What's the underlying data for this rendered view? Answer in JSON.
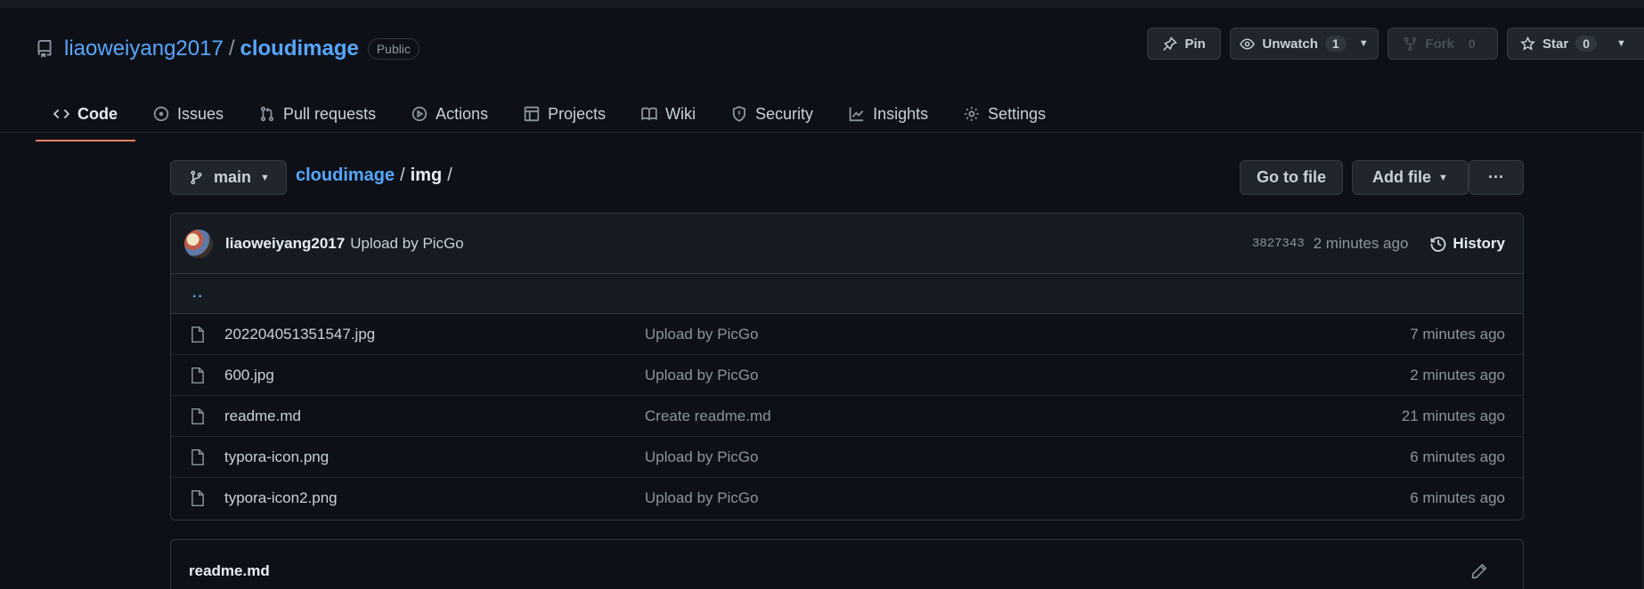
{
  "repo": {
    "owner": "liaoweiyang2017",
    "separator": "/",
    "name": "cloudimage",
    "visibility": "Public"
  },
  "header_buttons": {
    "pin": {
      "label": "Pin"
    },
    "unwatch": {
      "label": "Unwatch",
      "count": "1"
    },
    "fork": {
      "label": "Fork",
      "count": "0"
    },
    "star": {
      "label": "Star",
      "count": "0"
    }
  },
  "tabs": [
    {
      "label": "Code",
      "icon": "code-icon",
      "active": true
    },
    {
      "label": "Issues",
      "icon": "issue-icon"
    },
    {
      "label": "Pull requests",
      "icon": "pull-request-icon"
    },
    {
      "label": "Actions",
      "icon": "play-icon"
    },
    {
      "label": "Projects",
      "icon": "table-icon"
    },
    {
      "label": "Wiki",
      "icon": "book-icon"
    },
    {
      "label": "Security",
      "icon": "shield-icon"
    },
    {
      "label": "Insights",
      "icon": "graph-icon"
    },
    {
      "label": "Settings",
      "icon": "gear-icon"
    }
  ],
  "branch": {
    "label": "main"
  },
  "breadcrumb": {
    "root": "cloudimage",
    "sep": "/",
    "dir": "img",
    "trail": "/"
  },
  "actions": {
    "go_to_file": "Go to file",
    "add_file": "Add file",
    "more": "···"
  },
  "latest_commit": {
    "user": "liaoweiyang2017",
    "message": "Upload by PicGo",
    "sha": "3827343",
    "time": "2 minutes ago",
    "history_label": "History"
  },
  "parent_dir": "..",
  "files": [
    {
      "name": "202204051351547.jpg",
      "message": "Upload by PicGo",
      "age": "7 minutes ago"
    },
    {
      "name": "600.jpg",
      "message": "Upload by PicGo",
      "age": "2 minutes ago"
    },
    {
      "name": "readme.md",
      "message": "Create readme.md",
      "age": "21 minutes ago"
    },
    {
      "name": "typora-icon.png",
      "message": "Upload by PicGo",
      "age": "6 minutes ago"
    },
    {
      "name": "typora-icon2.png",
      "message": "Upload by PicGo",
      "age": "6 minutes ago"
    }
  ],
  "readme": {
    "title": "readme.md"
  },
  "colors": {
    "bg": "#0d1117",
    "link": "#58a6ff",
    "active_tab_underline": "#f78166",
    "border": "#30363d"
  }
}
